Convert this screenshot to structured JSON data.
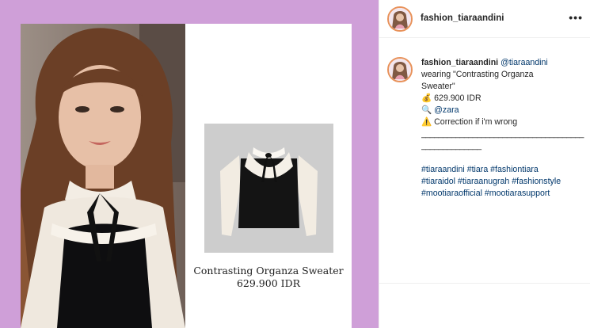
{
  "post": {
    "product_name_line1": "Contrasting Organza Sweater",
    "product_price": "629.900 IDR",
    "background_color": "#cf9fd8"
  },
  "header": {
    "username": "fashion_tiaraandini",
    "more_icon": "more-options-icon"
  },
  "caption": {
    "username": "fashion_tiaraandini",
    "mention": "@tiaraandini",
    "line1_rest": "wearing \"Contrasting Organza",
    "line2": "Sweater\"",
    "price_emoji": "💰",
    "price": "629.900 IDR",
    "brand_emoji": "🔍",
    "brand": "@zara",
    "warning_emoji": "⚠️",
    "correction": "Correction if i'm wrong",
    "divider1": "______________________________________",
    "divider2": "______________",
    "hashtags_line1": "#tiaraandini #tiara #fashiontiara",
    "hashtags_line2": "#tiaraidol #tiaraanugrah #fashionstyle",
    "hashtags_line3": "#mootiaraofficial #mootiarasupport"
  },
  "colors": {
    "link": "#00376b",
    "text": "#262626",
    "avatar_ring": "#e8925a"
  }
}
